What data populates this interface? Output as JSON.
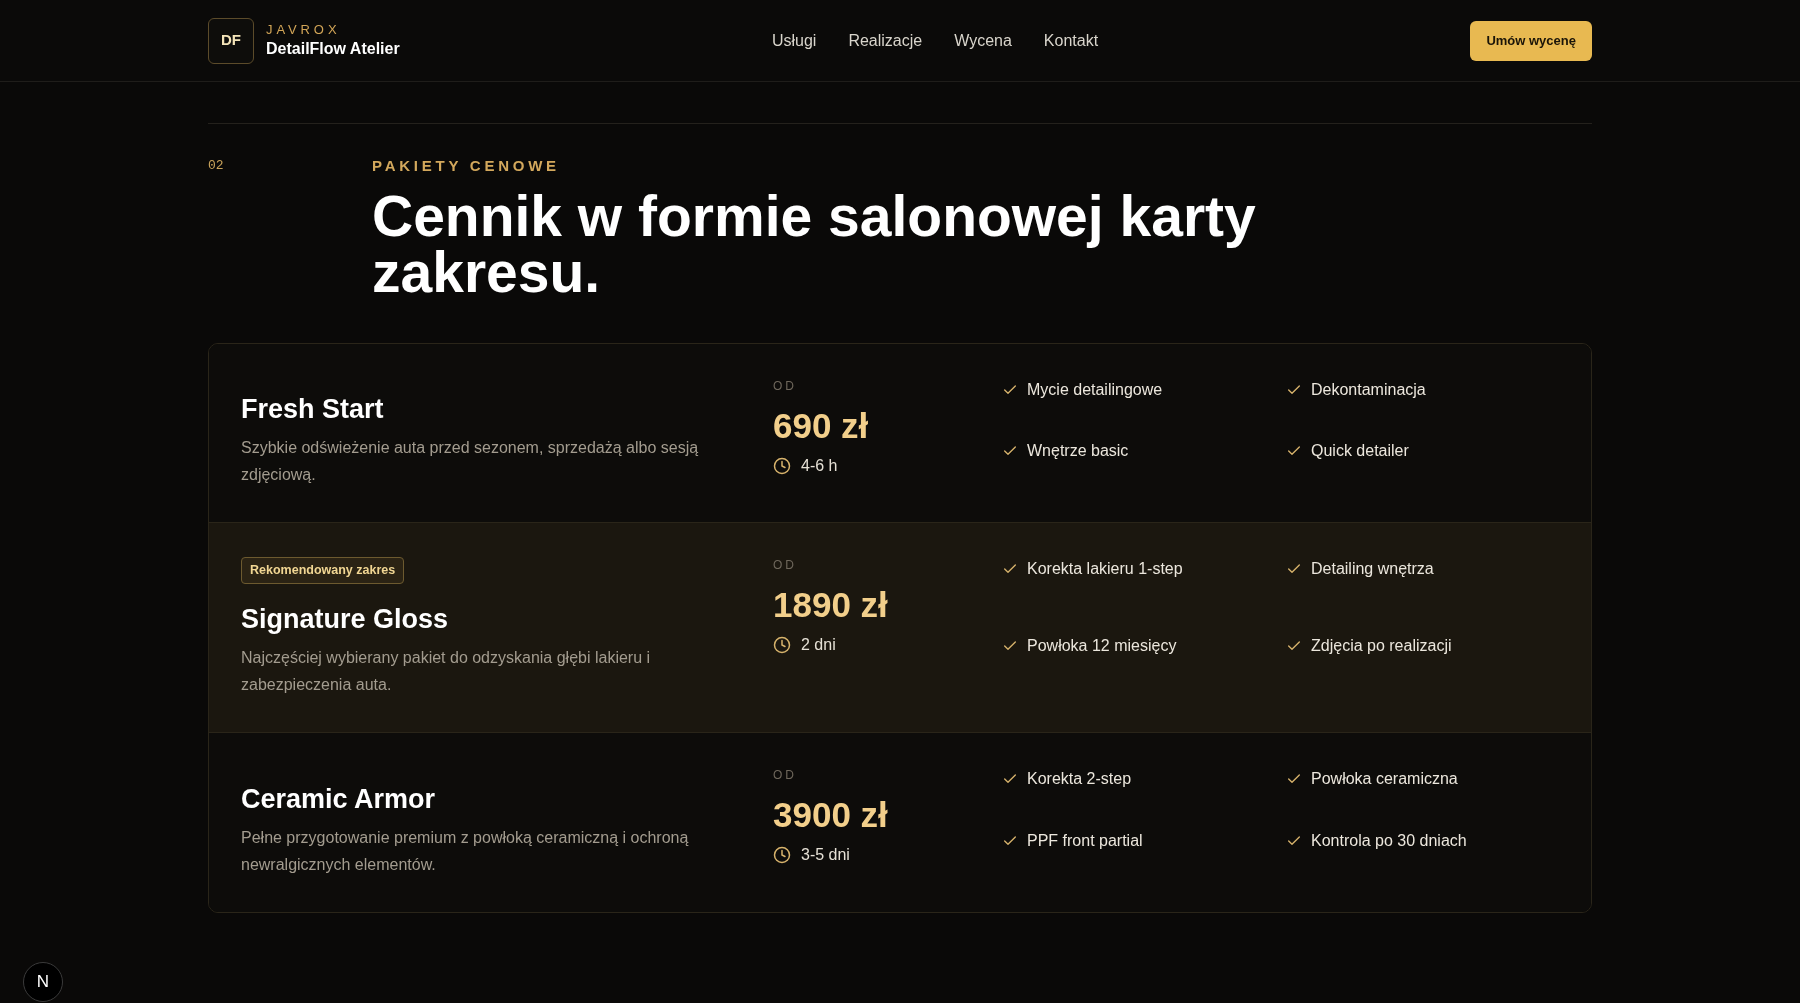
{
  "header": {
    "logo_mark": "DF",
    "brand_kicker": "JAVROX",
    "brand_name": "DetailFlow Atelier",
    "nav": [
      "Usługi",
      "Realizacje",
      "Wycena",
      "Kontakt"
    ],
    "cta": "Umów wycenę"
  },
  "section": {
    "number": "02",
    "eyebrow": "PAKIETY CENOWE",
    "title": "Cennik w formie salonowej karty zakresu."
  },
  "packages": [
    {
      "highlighted": false,
      "name": "Fresh Start",
      "description": "Szybkie odświeżenie auta przed sezonem, sprzedażą albo sesją zdjęciową.",
      "price_prefix": "OD",
      "price": "690 zł",
      "duration": "4-6 h",
      "features": [
        "Mycie detailingowe",
        "Dekontaminacja",
        "Wnętrze basic",
        "Quick detailer"
      ]
    },
    {
      "highlighted": true,
      "badge": "Rekomendowany zakres",
      "name": "Signature Gloss",
      "description": "Najczęściej wybierany pakiet do odzyskania głębi lakieru i zabezpieczenia auta.",
      "price_prefix": "OD",
      "price": "1890 zł",
      "duration": "2 dni",
      "features": [
        "Korekta lakieru 1-step",
        "Detailing wnętrza",
        "Powłoka 12 miesięcy",
        "Zdjęcia po realizacji"
      ]
    },
    {
      "highlighted": false,
      "name": "Ceramic Armor",
      "description": "Pełne przygotowanie premium z powłoką ceramiczną i ochroną newralgicznych elementów.",
      "price_prefix": "OD",
      "price": "3900 zł",
      "duration": "3-5 dni",
      "features": [
        "Korekta 2-step",
        "Powłoka ceramiczna",
        "PPF front partial",
        "Kontrola po 30 dniach"
      ]
    }
  ],
  "dev_indicator": "N"
}
